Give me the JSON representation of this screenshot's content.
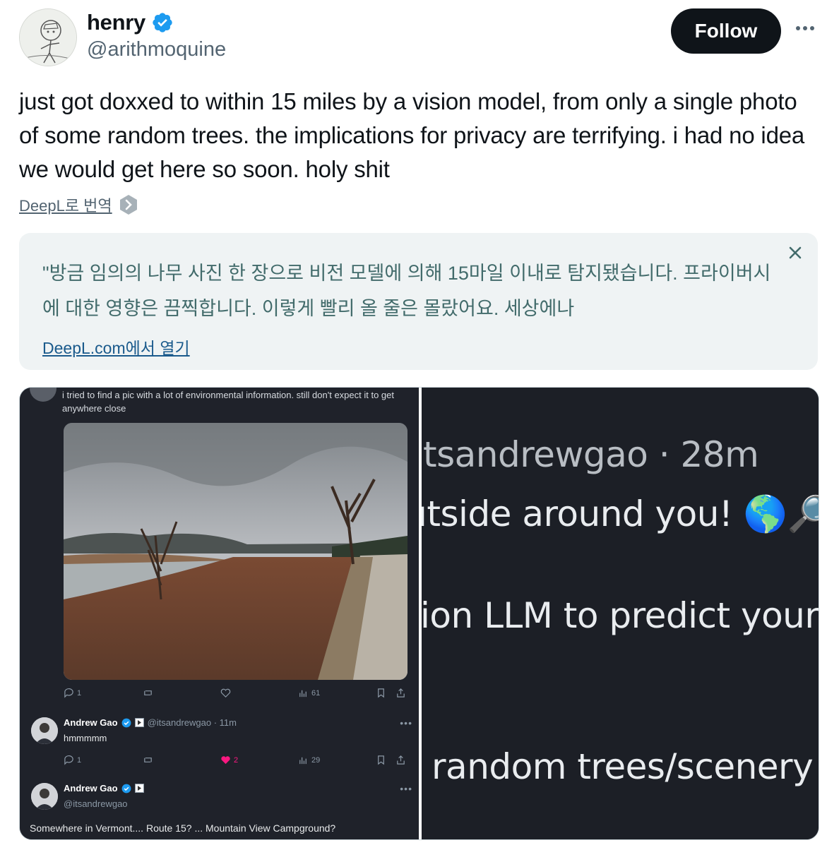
{
  "author": {
    "display_name": "henry",
    "handle": "@arithmoquine",
    "verified": true
  },
  "actions": {
    "follow_label": "Follow"
  },
  "tweet": {
    "text": "just got doxxed to within 15 miles by a vision model, from only a single photo of some random trees. the implications for privacy are terrifying. i had no idea we would get here so soon. holy shit",
    "translate_link": "DeepL로 번역"
  },
  "translation": {
    "text": "\"방금 임의의 나무 사진 한 장으로 비전 모델에 의해 15마일 이내로 탐지됐습니다. 프라이버시에 대한 영향은 끔찍합니다. 이렇게 빨리 올 줄은 몰랐어요. 세상에나",
    "open_link": "DeepL.com에서 열기"
  },
  "embedded_left": {
    "caption": "i tried to find a pic with a lot of environmental information. still don't expect it to get anywhere close",
    "stats": {
      "replies": "1",
      "views": "61"
    },
    "reply1": {
      "name": "Andrew Gao",
      "handle": "@itsandrewgao · 11m",
      "body": "hmmmmm",
      "stats": {
        "replies": "1",
        "likes": "2",
        "views": "29"
      }
    },
    "reply2": {
      "name": "Andrew Gao",
      "handle": "@itsandrewgao",
      "body": "Somewhere in Vermont.... Route 15? ... Mountain View Campground?"
    }
  },
  "embedded_right": {
    "line1": "tsandrewgao · 28m",
    "line2": "ıtside around you! 🌎🔎",
    "line3": "ion LLM to predict your",
    "line4": "random trees/scenery"
  },
  "colors": {
    "follow_bg": "#0f1419",
    "verified_blue": "#1d9bf0",
    "translation_bg": "#eff3f4",
    "translation_text": "#426b6b",
    "link_blue": "#1a5a8c",
    "dark_panel": "#1f222a",
    "like_pink": "#f91880"
  }
}
